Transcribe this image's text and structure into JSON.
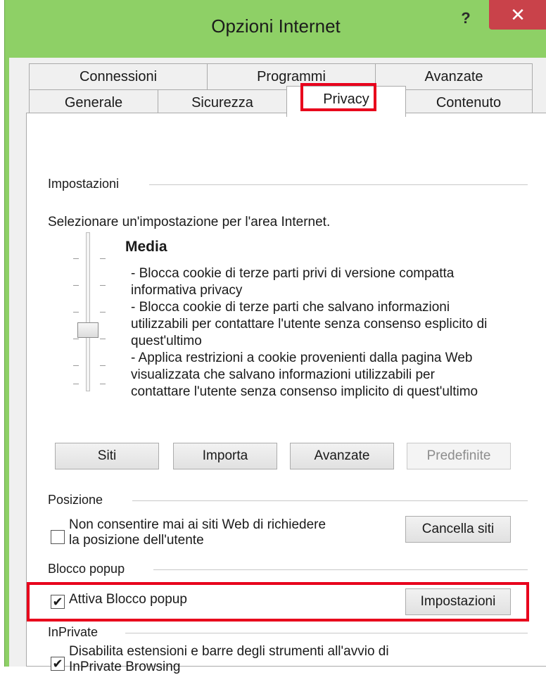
{
  "window": {
    "title": "Opzioni Internet",
    "help_label": "?",
    "close_label": "✕"
  },
  "tabs": {
    "row1": [
      "Connessioni",
      "Programmi",
      "Avanzate"
    ],
    "row2": [
      "Generale",
      "Sicurezza",
      "Privacy",
      "Contenuto"
    ],
    "active": "Privacy"
  },
  "settings": {
    "section_label": "Impostazioni",
    "instruction": "Selezionare un'impostazione per l'area Internet.",
    "level": "Media",
    "description_lines": [
      "- Blocca cookie di terze parti privi di versione compatta",
      "informativa privacy",
      "- Blocca cookie di terze parti che salvano informazioni",
      "utilizzabili per contattare l'utente senza consenso esplicito di",
      "quest'ultimo",
      "- Applica restrizioni a cookie provenienti dalla pagina Web",
      "visualizzata che salvano informazioni utilizzabili per",
      "contattare l'utente senza consenso implicito di quest'ultimo"
    ],
    "buttons": {
      "sites": "Siti",
      "import": "Importa",
      "advanced": "Avanzate",
      "default": "Predefinite"
    }
  },
  "location": {
    "section_label": "Posizione",
    "checkbox_label_line1": "Non consentire mai ai siti Web di richiedere",
    "checkbox_label_line2": "la posizione dell'utente",
    "checked": false,
    "clear_button": "Cancella siti"
  },
  "popup": {
    "section_label": "Blocco popup",
    "checkbox_label": "Attiva Blocco popup",
    "checked": true,
    "settings_button": "Impostazioni"
  },
  "inprivate": {
    "section_label": "InPrivate",
    "checkbox_label_line1": "Disabilita estensioni e barre degli strumenti all'avvio di",
    "checkbox_label_line2": "InPrivate Browsing",
    "checked": true
  },
  "checkmark": "✔",
  "colors": {
    "titlebar": "#8ed066",
    "close_button": "#c9424a",
    "highlight": "#e8001c"
  }
}
